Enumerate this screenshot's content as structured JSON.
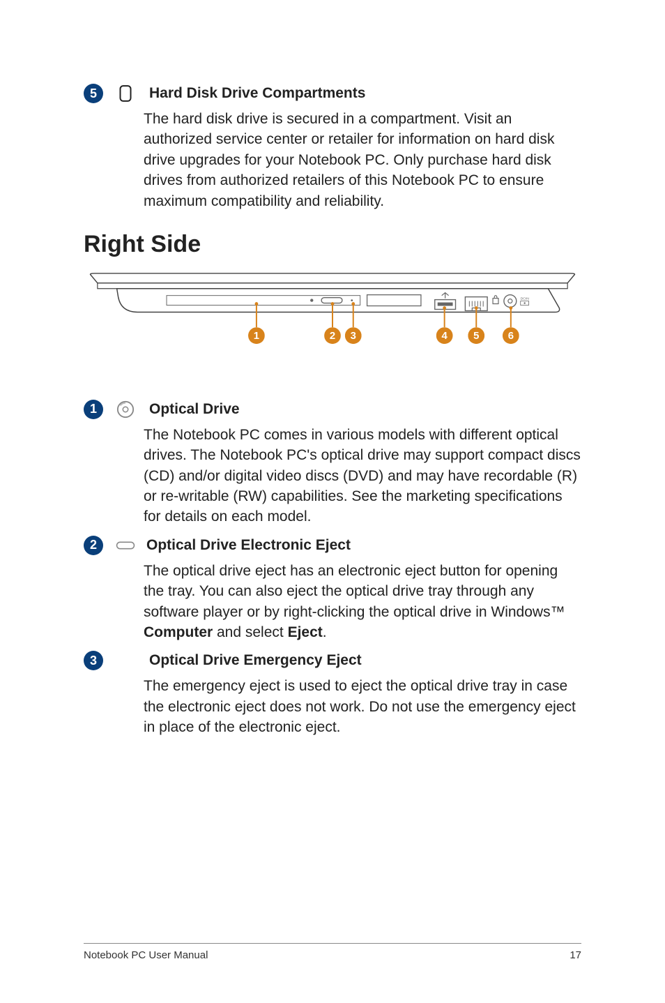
{
  "sections": {
    "hdd": {
      "num": "5",
      "title": "Hard Disk Drive Compartments",
      "body": "The hard disk drive is secured in a compartment. Visit an authorized service center or retailer for information on hard disk drive upgrades for your Notebook PC. Only purchase hard disk drives from authorized retailers of this Notebook PC to ensure maximum compatibility and reliability."
    }
  },
  "heading": "Right Side",
  "callouts": {
    "c1": "1",
    "c2": "2",
    "c3": "3",
    "c4": "4",
    "c5": "5",
    "c6": "6"
  },
  "right": {
    "optical": {
      "num": "1",
      "title": "Optical Drive",
      "body": "The Notebook PC comes in various models with different optical drives. The Notebook PC's optical drive may support compact discs (CD) and/or digital video discs (DVD) and may have recordable (R) or re-writable (RW) capabilities. See the marketing specifications for details on each model."
    },
    "eject": {
      "num": "2",
      "title": "Optical Drive Electronic Eject",
      "body_pre": "The optical drive eject has an electronic eject button for opening the tray. You can also eject the optical drive tray through any software player or by right-clicking the optical drive in Windows™ ",
      "body_bold1": "Computer",
      "body_mid": " and select ",
      "body_bold2": "Eject",
      "body_post": "."
    },
    "emergency": {
      "num": "3",
      "title": "Optical Drive Emergency Eject",
      "body": "The emergency eject is used to eject the optical drive tray in case the electronic eject does not work. Do not use the emergency eject in place of the electronic eject."
    }
  },
  "footer": {
    "left": "Notebook PC User Manual",
    "right": "17"
  }
}
